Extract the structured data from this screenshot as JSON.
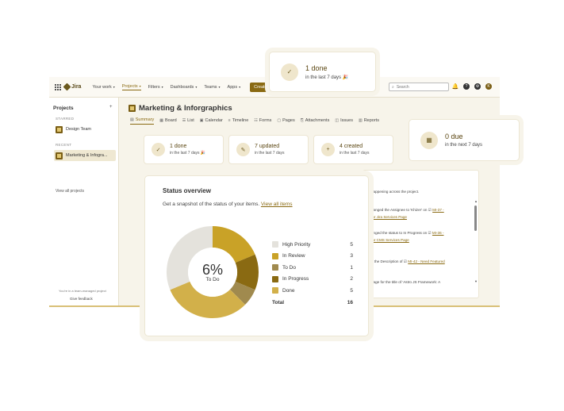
{
  "topbar": {
    "logo": "Jira",
    "nav": [
      {
        "label": "Your work",
        "active": false
      },
      {
        "label": "Projects",
        "active": true
      },
      {
        "label": "Filters",
        "active": false
      },
      {
        "label": "Dashboards",
        "active": false
      },
      {
        "label": "Teams",
        "active": false
      },
      {
        "label": "Apps",
        "active": false
      }
    ],
    "create_label": "Create",
    "search_placeholder": "Search",
    "avatar_initial": "K"
  },
  "sidebar": {
    "title": "Projects",
    "starred_label": "STARRED",
    "starred_item": "Design Team",
    "recent_label": "RECENT",
    "recent_item": "Marketing & Infogra...",
    "view_all": "View all projects",
    "footer_note": "You're in a team-managed project",
    "feedback": "Give feedback"
  },
  "project": {
    "title": "Marketing & Inforgraphics",
    "tabs": [
      "Summary",
      "Board",
      "List",
      "Calendar",
      "Timeline",
      "Forms",
      "Pages",
      "Attachments",
      "Issues",
      "Reports"
    ]
  },
  "stats": [
    {
      "main": "1 done",
      "sub": "in the last 7 days",
      "icon": "check-icon"
    },
    {
      "main": "7 updated",
      "sub": "in the last 7 days",
      "icon": "pencil-icon"
    },
    {
      "main": "4 created",
      "sub": "in the last 7 days",
      "icon": "plus-icon"
    }
  ],
  "float_done": {
    "main": "1 done",
    "sub": "in the last 7 days"
  },
  "float_due": {
    "main": "0 due",
    "sub": "in the next 7 days"
  },
  "activity": {
    "lines": [
      {
        "text": "happening across the project.",
        "link": ""
      },
      {
        "text": "hanged the Assignee to 'Khizer' on ",
        "link": "MI-37 -"
      },
      {
        "text": "",
        "link": "for Jira Services Page"
      },
      {
        "text": "anged the status to In Progress on ",
        "link": "MI-36 -"
      },
      {
        "text": "",
        "link": "for CMS Services Page"
      },
      {
        "text": "d the Description of ",
        "link": "MI-42 - Need Featured"
      },
      {
        "text": "",
        "link": ""
      },
      {
        "text": "nage for the title of 'Astro JS Framework: A",
        "link": ""
      }
    ]
  },
  "status_overview": {
    "title": "Status overview",
    "description": "Get a snapshot of the status of your items.",
    "link": "View all items",
    "center_pct": "6%",
    "center_label": "To Do",
    "total_label": "Total",
    "total_value": "16"
  },
  "chart_data": {
    "type": "pie",
    "categories": [
      "High Priority",
      "In Review",
      "To Do",
      "In Progress",
      "Done"
    ],
    "values": [
      5,
      3,
      1,
      2,
      5
    ],
    "colors": [
      "#e4e2dc",
      "#c9a227",
      "#a08a4e",
      "#8a6a12",
      "#d2b04a"
    ]
  }
}
